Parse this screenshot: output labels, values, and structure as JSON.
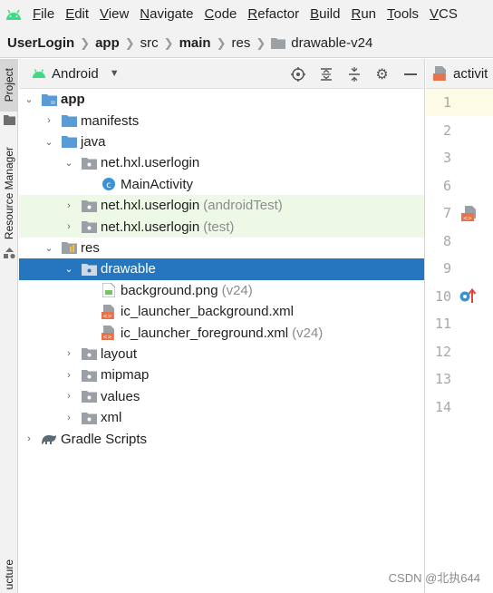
{
  "menu": {
    "items": [
      "File",
      "Edit",
      "View",
      "Navigate",
      "Code",
      "Refactor",
      "Build",
      "Run",
      "Tools",
      "VCS"
    ]
  },
  "breadcrumb": {
    "items": [
      "UserLogin",
      "app",
      "src",
      "main",
      "res",
      "drawable-v24"
    ]
  },
  "sidebar": {
    "project_tab": "Project",
    "resource_manager_tab": "Resource Manager",
    "structure_tab": "ucture"
  },
  "panel": {
    "view_label": "Android"
  },
  "tree": [
    {
      "label": "app",
      "hint": ""
    },
    {
      "label": "manifests",
      "hint": ""
    },
    {
      "label": "java",
      "hint": ""
    },
    {
      "label": "net.hxl.userlogin",
      "hint": ""
    },
    {
      "label": "MainActivity",
      "hint": ""
    },
    {
      "label": "net.hxl.userlogin",
      "hint": "(androidTest)"
    },
    {
      "label": "net.hxl.userlogin",
      "hint": "(test)"
    },
    {
      "label": "res",
      "hint": ""
    },
    {
      "label": "drawable",
      "hint": ""
    },
    {
      "label": "background.png",
      "hint": "(v24)"
    },
    {
      "label": "ic_launcher_background.xml",
      "hint": ""
    },
    {
      "label": "ic_launcher_foreground.xml",
      "hint": "(v24)"
    },
    {
      "label": "layout",
      "hint": ""
    },
    {
      "label": "mipmap",
      "hint": ""
    },
    {
      "label": "values",
      "hint": ""
    },
    {
      "label": "xml",
      "hint": ""
    },
    {
      "label": "Gradle Scripts",
      "hint": ""
    }
  ],
  "editor": {
    "tab_label": "activit",
    "line_numbers": [
      "1",
      "2",
      "3",
      "6",
      "7",
      "8",
      "9",
      "10",
      "11",
      "12",
      "13",
      "14"
    ]
  },
  "watermark": "CSDN @北执644",
  "colors": {
    "selection": "#2675bf",
    "test_row_bg": "#eef8e6",
    "android_green": "#3ddc84",
    "folder_blue": "#5a9bd5",
    "xml_orange": "#e8734a"
  }
}
